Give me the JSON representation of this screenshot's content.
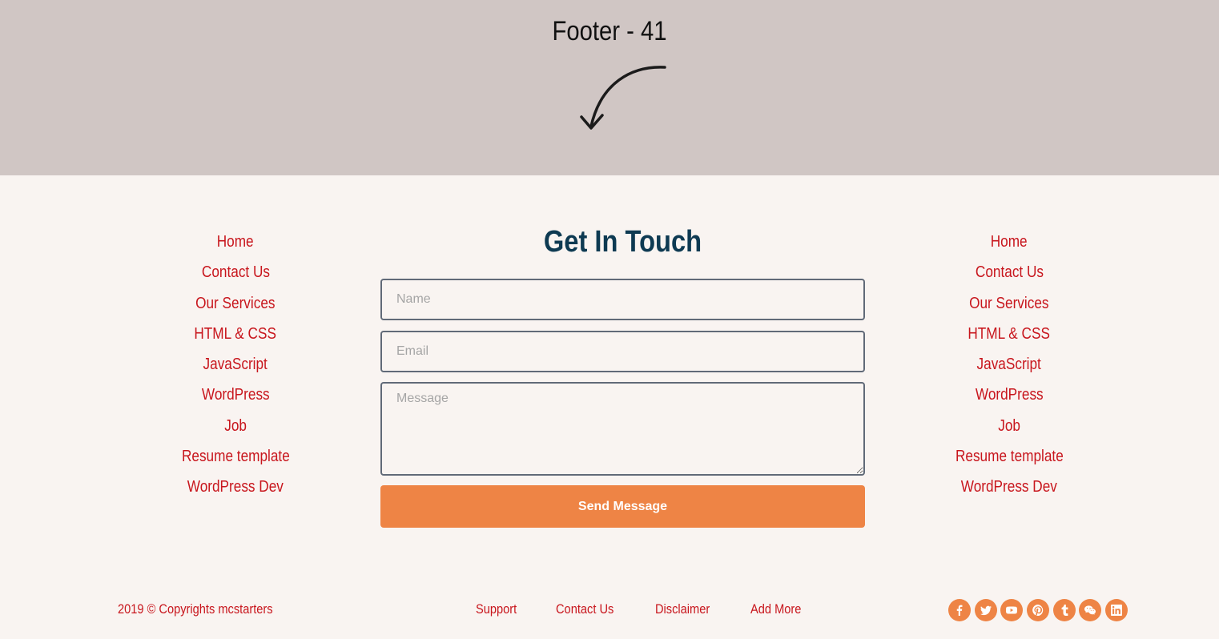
{
  "hero": {
    "title": "Footer - 41"
  },
  "left_links": [
    "Home",
    "Contact Us",
    "Our Services",
    "HTML & CSS",
    "JavaScript",
    "WordPress",
    "Job",
    "Resume template",
    "WordPress Dev"
  ],
  "right_links": [
    "Home",
    "Contact Us",
    "Our Services",
    "HTML & CSS",
    "JavaScript",
    "WordPress",
    "Job",
    "Resume template",
    "WordPress Dev"
  ],
  "contact": {
    "title": "Get In Touch",
    "name_placeholder": "Name",
    "email_placeholder": "Email",
    "message_placeholder": "Message",
    "send_label": "Send Message"
  },
  "bottom": {
    "copyright": "2019 © Copyrights mcstarters",
    "links": [
      "Support",
      "Contact Us",
      "Disclaimer",
      "Add More"
    ],
    "socials": [
      "facebook-icon",
      "twitter-icon",
      "youtube-icon",
      "pinterest-icon",
      "tumblr-icon",
      "wechat-icon",
      "linkedin-icon"
    ]
  },
  "colors": {
    "hero_bg": "#d0c6c4",
    "footer_bg": "#f9f4f1",
    "link": "#c8161d",
    "heading": "#0e3a52",
    "accent": "#ee8445"
  }
}
